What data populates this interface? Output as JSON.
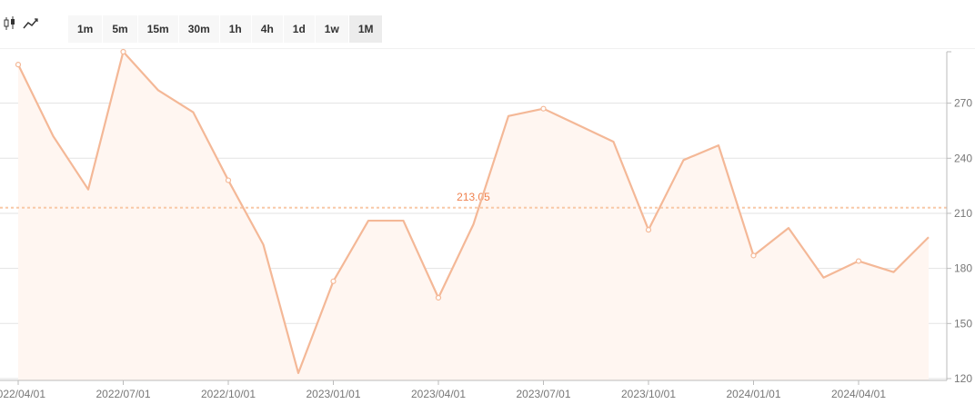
{
  "toolbar": {
    "candle_icon": "candlestick-icon",
    "line_icon": "line-chart-icon",
    "intervals": [
      "1m",
      "5m",
      "15m",
      "30m",
      "1h",
      "4h",
      "1d",
      "1w",
      "1M"
    ],
    "active_interval": "1M"
  },
  "colors": {
    "line": "#f4b897",
    "area": "#fff6f1",
    "ref": "#f8c9a8",
    "ref_text": "#f0814e",
    "grid": "#e3e3e3"
  },
  "chart_data": {
    "type": "area",
    "x": [
      "2022/04/01",
      "2022/05/01",
      "2022/06/01",
      "2022/07/01",
      "2022/08/01",
      "2022/09/01",
      "2022/10/01",
      "2022/11/01",
      "2022/12/01",
      "2023/01/01",
      "2023/02/01",
      "2023/03/01",
      "2023/04/01",
      "2023/05/01",
      "2023/06/01",
      "2023/07/01",
      "2023/08/01",
      "2023/09/01",
      "2023/10/01",
      "2023/11/01",
      "2023/12/01",
      "2024/01/01",
      "2024/02/01",
      "2024/03/01",
      "2024/04/01",
      "2024/05/01",
      "2024/06/01"
    ],
    "series": [
      {
        "values": [
          291,
          252,
          223,
          298,
          277,
          265,
          228,
          193,
          123,
          173,
          206,
          206,
          164,
          204,
          263,
          267,
          258,
          249,
          201,
          239,
          247,
          187,
          202,
          175,
          184,
          178,
          197
        ]
      }
    ],
    "xticks": [
      "2022/04/01",
      "2022/07/01",
      "2022/10/01",
      "2023/01/01",
      "2023/04/01",
      "2023/07/01",
      "2023/10/01",
      "2024/01/01",
      "2024/04/01"
    ],
    "yticks": [
      120,
      150,
      180,
      210,
      240,
      270
    ],
    "ylim": [
      119,
      298
    ],
    "reference_line": {
      "value": 213.05,
      "label": "213.05"
    },
    "marked_points": [
      0,
      3,
      6,
      9,
      12,
      15,
      18,
      21,
      24
    ],
    "grid": true,
    "y_axis_side": "right"
  }
}
